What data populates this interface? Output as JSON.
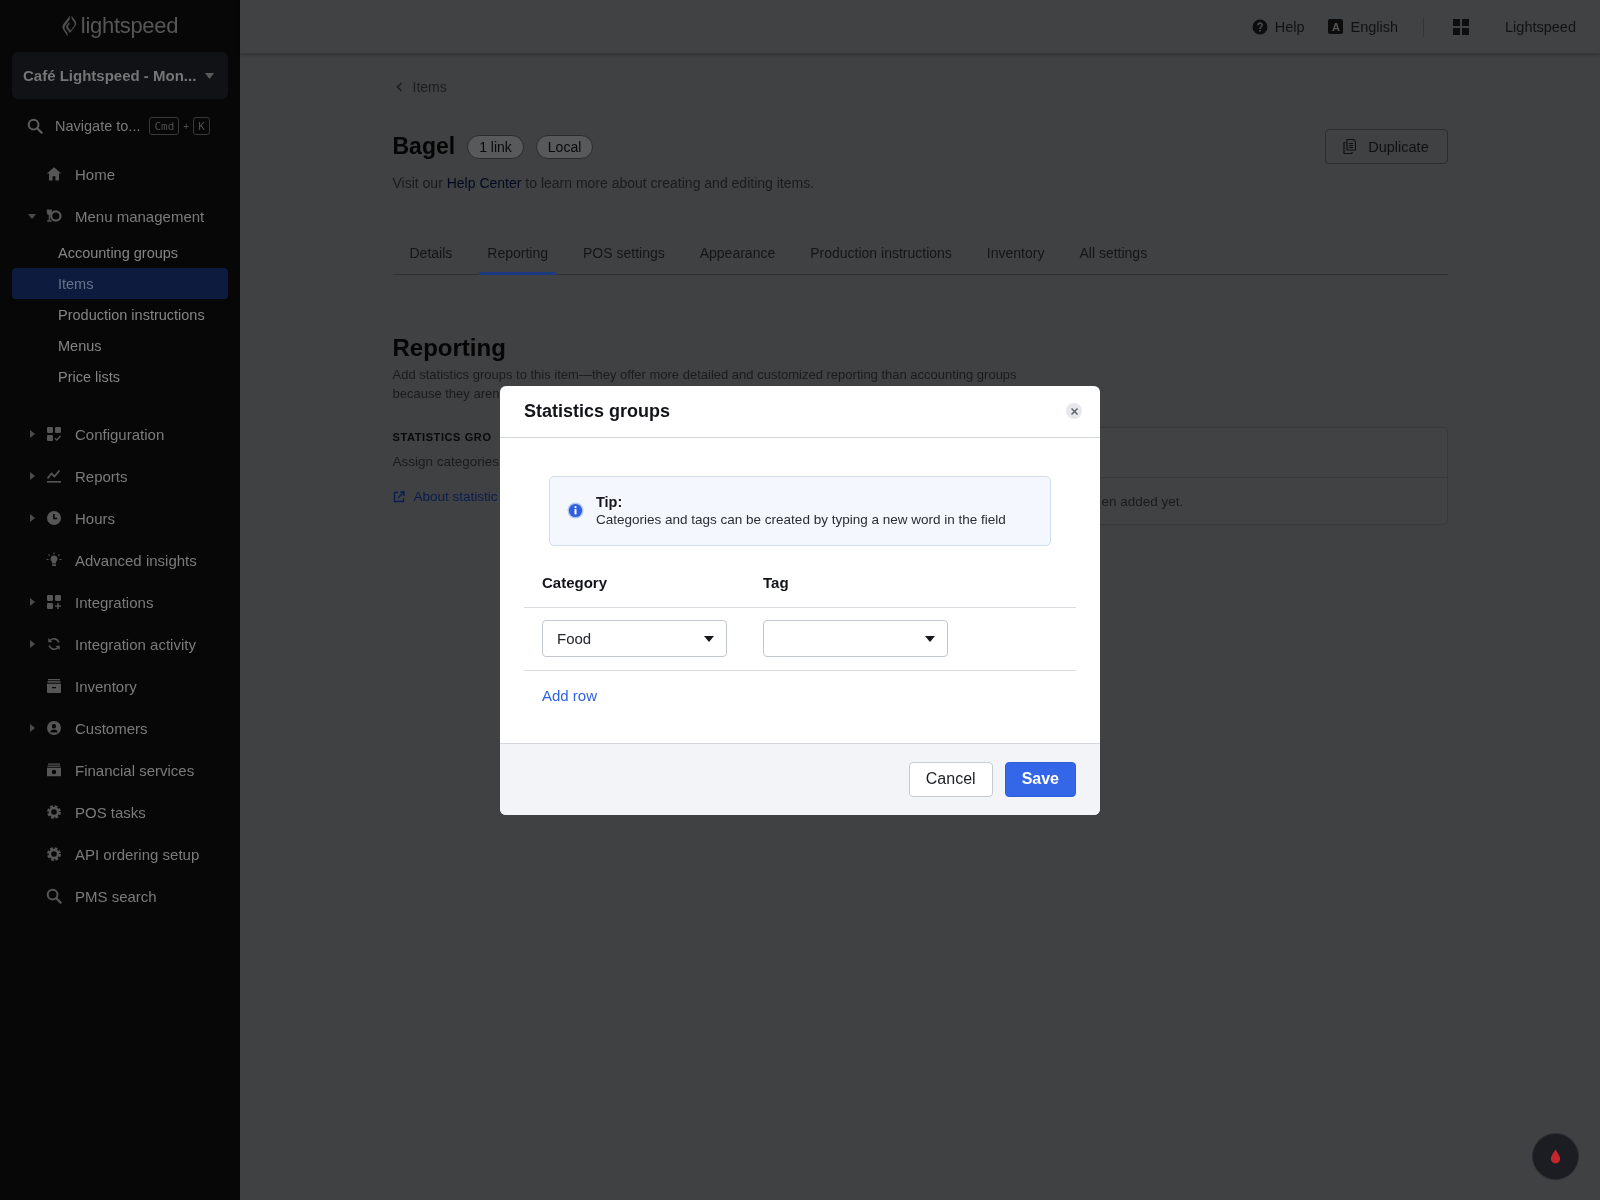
{
  "sidebar": {
    "logo": "lightspeed",
    "location": "Café Lightspeed - Mon...",
    "navigate": {
      "label": "Navigate to...",
      "keys": [
        "Cmd",
        "K"
      ],
      "joiner": "+"
    },
    "items": [
      {
        "kind": "link",
        "label": "Home"
      },
      {
        "kind": "group",
        "label": "Menu management",
        "expanded": true,
        "children": [
          {
            "label": "Accounting groups",
            "selected": false
          },
          {
            "label": "Items",
            "selected": true
          },
          {
            "label": "Production instructions",
            "selected": false
          },
          {
            "label": "Menus",
            "selected": false
          },
          {
            "label": "Price lists",
            "selected": false
          }
        ]
      },
      {
        "kind": "group",
        "label": "Configuration",
        "expanded": false
      },
      {
        "kind": "group",
        "label": "Reports",
        "expanded": false
      },
      {
        "kind": "group",
        "label": "Hours",
        "expanded": false
      },
      {
        "kind": "link",
        "label": "Advanced insights"
      },
      {
        "kind": "group",
        "label": "Integrations",
        "expanded": false
      },
      {
        "kind": "group",
        "label": "Integration activity",
        "expanded": false
      },
      {
        "kind": "link",
        "label": "Inventory"
      },
      {
        "kind": "group",
        "label": "Customers",
        "expanded": false
      },
      {
        "kind": "link",
        "label": "Financial services"
      },
      {
        "kind": "link",
        "label": "POS tasks"
      },
      {
        "kind": "link",
        "label": "API ordering setup"
      },
      {
        "kind": "link",
        "label": "PMS search"
      }
    ]
  },
  "top_bar": {
    "help": "Help",
    "language": {
      "glyph": "A",
      "label": "English"
    },
    "account": "Lightspeed"
  },
  "breadcrumb": "Items",
  "header": {
    "title": "Bagel",
    "badges": [
      "1 link",
      "Local"
    ],
    "action": "Duplicate",
    "subtitle": {
      "before": "Visit our",
      "link": "Help Center",
      "after": "to learn more about creating and editing items."
    }
  },
  "tabs": [
    {
      "label": "Details",
      "selected": false
    },
    {
      "label": "Reporting",
      "selected": true
    },
    {
      "label": "POS settings",
      "selected": false
    },
    {
      "label": "Appearance",
      "selected": false
    },
    {
      "label": "Production instructions",
      "selected": false
    },
    {
      "label": "Inventory",
      "selected": false
    },
    {
      "label": "All settings",
      "selected": false
    }
  ],
  "reporting": {
    "title": "Reporting",
    "description_lines": [
      "Add statistics groups to this item—they offer more detailed and customized reporting than accounting groups",
      "because they aren"
    ],
    "statistics": {
      "heading": "STATISTICS GRO",
      "hint": "Assign categories",
      "link": "About statistic",
      "empty_text": "en added yet."
    }
  },
  "modal": {
    "title": "Statistics groups",
    "tip": {
      "title": "Tip:",
      "text": "Categories and tags can be created by typing a new word in the field"
    },
    "columns": [
      "Category",
      "Tag"
    ],
    "rows": [
      {
        "category": "Food"
      }
    ],
    "add_row": "Add row",
    "buttons": [
      {
        "label": "Cancel",
        "kind": "secondary"
      },
      {
        "label": "Save",
        "kind": "primary"
      }
    ]
  }
}
